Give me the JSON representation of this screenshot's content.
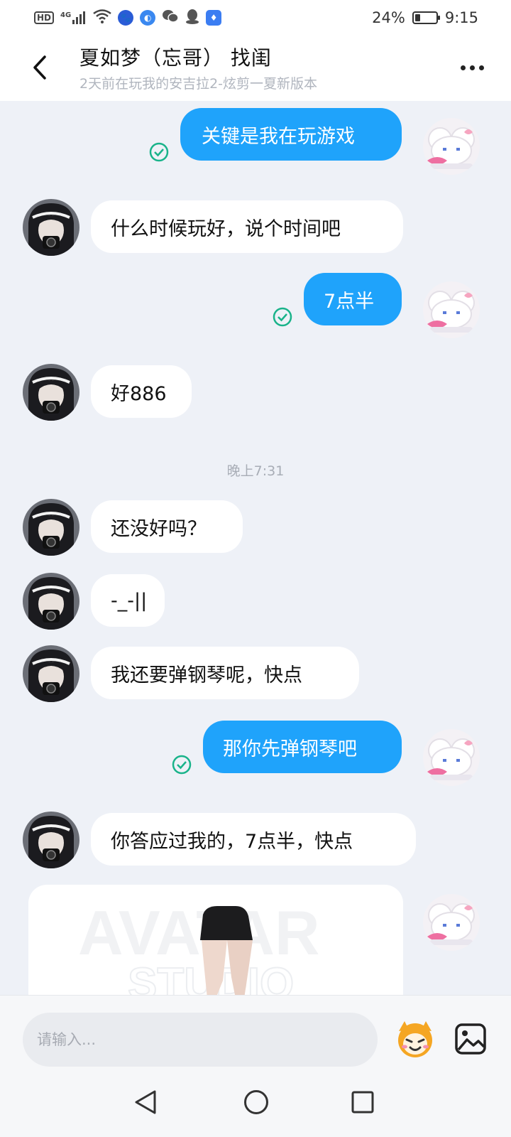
{
  "status_bar": {
    "hd": "HD",
    "signal": "4G",
    "battery": "24%",
    "battery_level": 0.24,
    "time": "9:15"
  },
  "header": {
    "title": "夏如梦（忘哥） 找闺",
    "subtitle": "2天前在玩我的安吉拉2-炫剪一夏新版本",
    "icons": [
      "back-arrow-icon",
      "more-dots-icon"
    ]
  },
  "messages": [
    {
      "side": "out",
      "text": "关键是我在玩游戏",
      "status": "read"
    },
    {
      "side": "in",
      "text": "什么时候玩好，说个时间吧"
    },
    {
      "side": "out",
      "text": "7点半",
      "status": "read"
    },
    {
      "side": "in",
      "text": "好886"
    },
    {
      "side": "in",
      "text": "还没好吗？"
    },
    {
      "side": "in",
      "text": "-_-||"
    },
    {
      "side": "in",
      "text": "我还要弹钢琴呢，快点"
    },
    {
      "side": "out",
      "text": "那你先弹钢琴吧",
      "status": "read"
    },
    {
      "side": "in",
      "text": "你答应过我的，7点半，快点"
    }
  ],
  "timestamp": "晚上7:31",
  "input": {
    "placeholder": "请输入..."
  },
  "colors": {
    "outgoing_bubble": "#1fa3fb",
    "incoming_bubble": "#ffffff",
    "background": "#eef1f7",
    "read_check": "#19b38a"
  }
}
